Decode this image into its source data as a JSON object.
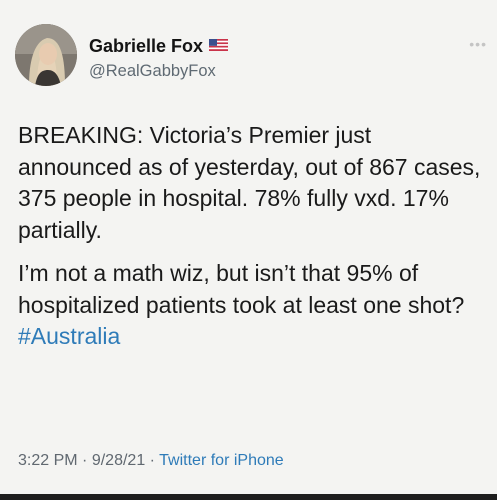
{
  "author": {
    "display_name": "Gabrielle Fox",
    "handle": "@RealGabbyFox",
    "flag_icon": "us-flag-icon"
  },
  "more_icon": "more-horizontal-icon",
  "tweet": {
    "paragraph_1": "BREAKING: Victoria’s Premier just announced as of yesterday, out of 867 cases, 375 people in hospital. 78% fully vxd. 17% partially.",
    "paragraph_2_text": "I’m not a math wiz, but isn’t that 95% of hospitalized patients took at least one shot?",
    "hashtag": "#Australia"
  },
  "meta": {
    "time": "3:22 PM",
    "separator": "·",
    "date": "9/28/21",
    "source": "Twitter for iPhone"
  },
  "colors": {
    "background": "#f4f4f2",
    "link": "#2e7bb8",
    "secondary_text": "#5f6a73"
  }
}
